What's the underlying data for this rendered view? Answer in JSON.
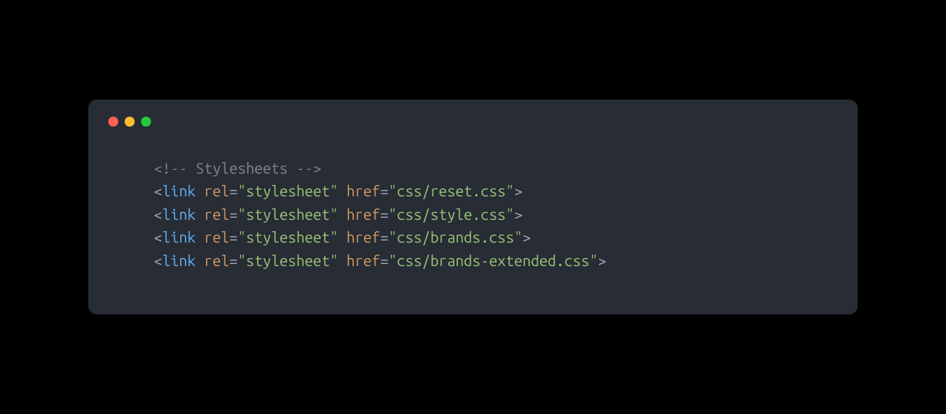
{
  "window": {
    "traffic_lights": {
      "red": "#ff5f56",
      "yellow": "#ffbd2e",
      "green": "#27c93f"
    }
  },
  "code": {
    "comment": {
      "open": "<!--",
      "text": " Stylesheets ",
      "close": "-->"
    },
    "lines": [
      {
        "open": "<",
        "tag": "link",
        "attr1": "rel",
        "eq1": "=",
        "val1": "\"stylesheet\"",
        "attr2": "href",
        "eq2": "=",
        "val2": "\"css/reset.css\"",
        "close": ">"
      },
      {
        "open": "<",
        "tag": "link",
        "attr1": "rel",
        "eq1": "=",
        "val1": "\"stylesheet\"",
        "attr2": "href",
        "eq2": "=",
        "val2": "\"css/style.css\"",
        "close": ">"
      },
      {
        "open": "<",
        "tag": "link",
        "attr1": "rel",
        "eq1": "=",
        "val1": "\"stylesheet\"",
        "attr2": "href",
        "eq2": "=",
        "val2": "\"css/brands.css\"",
        "close": ">"
      },
      {
        "open": "<",
        "tag": "link",
        "attr1": "rel",
        "eq1": "=",
        "val1": "\"stylesheet\"",
        "attr2": "href",
        "eq2": "=",
        "val2": "\"css/brands-extended.css\"",
        "close": ">"
      }
    ]
  }
}
